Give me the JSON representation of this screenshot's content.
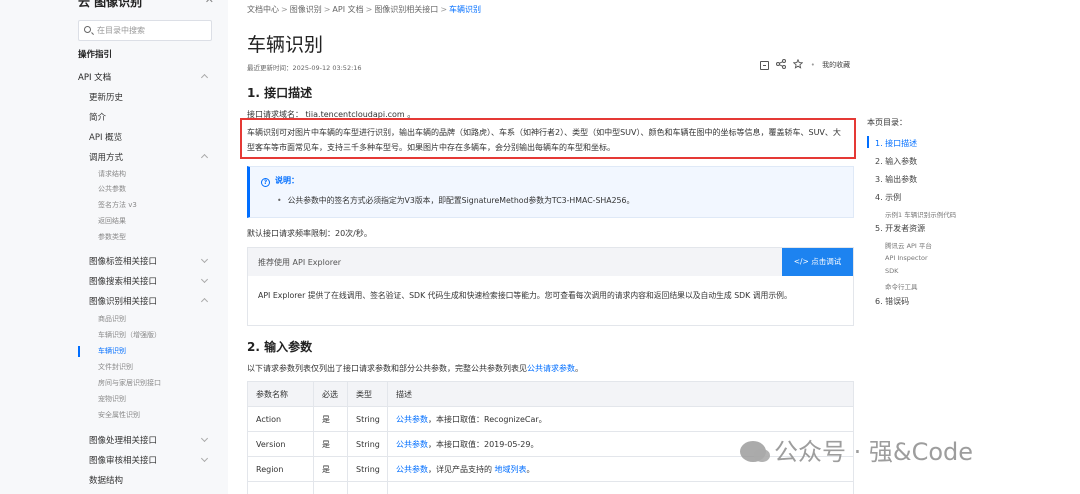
{
  "sidebar": {
    "header": "云 图像识别",
    "close": "✕",
    "search_placeholder": "在目录中搜索",
    "items": [
      {
        "label": "操作指引"
      },
      {
        "label": "API 文档"
      },
      {
        "label": "更新历史"
      },
      {
        "label": "简介"
      },
      {
        "label": "API 概览"
      },
      {
        "label": "调用方式"
      },
      {
        "label": "请求结构"
      },
      {
        "label": "公共参数"
      },
      {
        "label": "签名方法 v3"
      },
      {
        "label": "返回结果"
      },
      {
        "label": "参数类型"
      },
      {
        "label": "图像标签相关接口"
      },
      {
        "label": "图像搜索相关接口"
      },
      {
        "label": "图像识别相关接口"
      },
      {
        "label": "商品识别"
      },
      {
        "label": "车辆识别（增强版）"
      },
      {
        "label": "车辆识别"
      },
      {
        "label": "文件封识别"
      },
      {
        "label": "房间与家居识别接口"
      },
      {
        "label": "宠物识别"
      },
      {
        "label": "安全属性识别"
      },
      {
        "label": "图像处理相关接口"
      },
      {
        "label": "图像审核相关接口"
      },
      {
        "label": "数据结构"
      }
    ]
  },
  "breadcrumb": {
    "items": [
      "文档中心",
      "图像识别",
      "API 文档",
      "图像识别相关接口"
    ],
    "current": "车辆识别",
    "separator": ">"
  },
  "page": {
    "title": "车辆识别",
    "updated": "最近更新时间：2025-09-12 03:52:16",
    "toolbar": {
      "favorite_label": "我的收藏"
    }
  },
  "section1": {
    "heading": "1. 接口描述",
    "domain_line": "接口请求域名： tiia.tencentcloudapi.com 。",
    "description": "车辆识别可对图片中车辆的车型进行识别，输出车辆的品牌（如路虎）、车系（如神行者2）、类型（如中型SUV）、颜色和车辆在图中的坐标等信息，覆盖轿车、SUV、大型客车等市面常见车，支持三千多种车型号。如果图片中存在多辆车，会分别输出每辆车的车型和坐标。",
    "note_title": "说明：",
    "note_body": "公共参数中的签名方式必须指定为V3版本，即配置SignatureMethod参数为TC3-HMAC-SHA256。",
    "rate_limit": "默认接口请求频率限制：20次/秒。",
    "explorer_title": "推荐使用 API Explorer",
    "explorer_button": "点击调试",
    "explorer_body": "API Explorer 提供了在线调用、签名验证、SDK 代码生成和快速检索接口等能力。您可查看每次调用的请求内容和返回结果以及自动生成 SDK 调用示例。"
  },
  "section2": {
    "heading": "2. 输入参数",
    "intro": "以下请求参数列表仅列出了接口请求参数和部分公共参数，完整公共参数列表见",
    "intro_link": "公共请求参数",
    "intro_end": "。",
    "table": {
      "headers": [
        "参数名称",
        "必选",
        "类型",
        "描述"
      ],
      "rows": [
        {
          "name": "Action",
          "required": "是",
          "type": "String",
          "link": "公共参数",
          "desc": "，本接口取值：RecognizeCar。",
          "desc_link2": "",
          "desc_end": ""
        },
        {
          "name": "Version",
          "required": "是",
          "type": "String",
          "link": "公共参数",
          "desc": "，本接口取值：2019-05-29。",
          "desc_link2": "",
          "desc_end": ""
        },
        {
          "name": "Region",
          "required": "是",
          "type": "String",
          "link": "公共参数",
          "desc": "，详见产品支持的 ",
          "desc_link2": "地域列表",
          "desc_end": "。"
        }
      ]
    }
  },
  "toc": {
    "title": "本页目录：",
    "items": [
      {
        "label": "1. 接口描述"
      },
      {
        "label": "2. 输入参数"
      },
      {
        "label": "3. 输出参数"
      },
      {
        "label": "4. 示例"
      },
      {
        "label": "示例1 车辆识别示例代码"
      },
      {
        "label": "5. 开发者资源"
      },
      {
        "label": "腾讯云 API 平台"
      },
      {
        "label": "API Inspector"
      },
      {
        "label": "SDK"
      },
      {
        "label": "命令行工具"
      },
      {
        "label": "6. 错误码"
      }
    ]
  },
  "watermark": "公众号 · 强&Code",
  "colors": {
    "accent": "#006eff",
    "highlight_border": "#e53935",
    "button_bg": "#1d83f0"
  }
}
